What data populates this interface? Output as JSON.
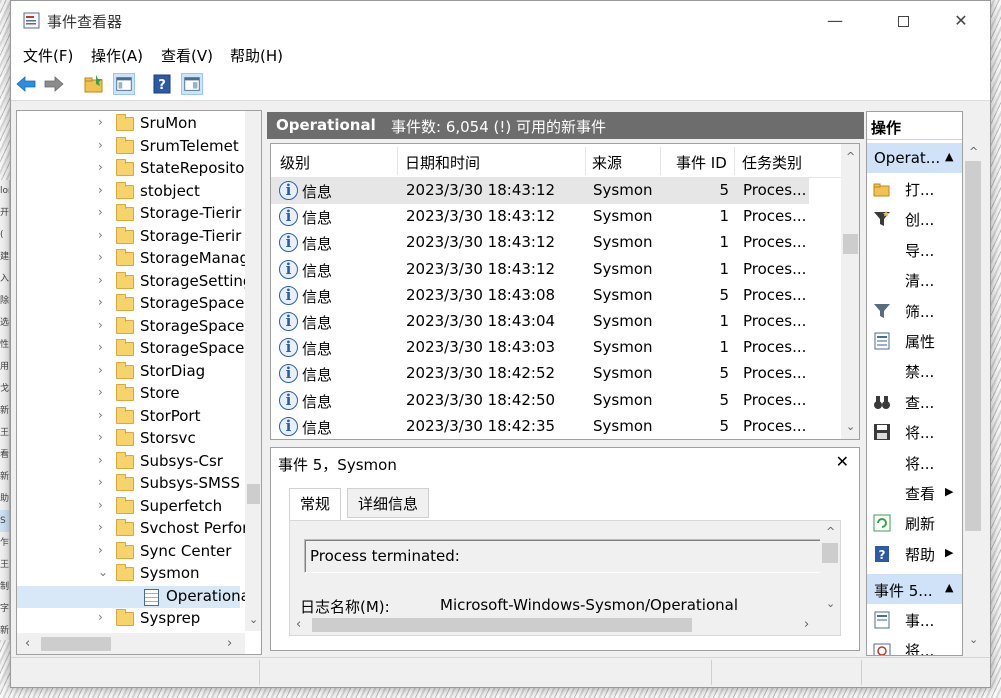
{
  "window": {
    "title": "事件查看器",
    "minimize_glyph": "—",
    "close_glyph": "✕"
  },
  "menu": [
    "文件(F)",
    "操作(A)",
    "查看(V)",
    "帮助(H)"
  ],
  "toolbar": {
    "icons": [
      "back-arrow-icon",
      "forward-arrow-icon",
      "open-folder-icon",
      "show-hide-tree-icon",
      "help-icon",
      "show-hide-action-pane-icon"
    ]
  },
  "left_edge": {
    "fragments": [
      "lor",
      "开(",
      "建",
      "入|",
      "除",
      "选",
      "性",
      "用|",
      "戈",
      "新",
      "王",
      "看",
      "新",
      "助",
      "S",
      "乍",
      "王",
      "制",
      "字",
      "新"
    ]
  },
  "tree": {
    "expand_glyph": "›",
    "collapse_glyph": "⌄",
    "items": [
      {
        "label": "SruMon",
        "state": "collapsed"
      },
      {
        "label": "SrumTelemet",
        "state": "collapsed"
      },
      {
        "label": "StateReposito",
        "state": "collapsed"
      },
      {
        "label": "stobject",
        "state": "collapsed"
      },
      {
        "label": "Storage-Tierir",
        "state": "collapsed"
      },
      {
        "label": "Storage-Tierir",
        "state": "collapsed"
      },
      {
        "label": "StorageManag",
        "state": "collapsed"
      },
      {
        "label": "StorageSetting",
        "state": "collapsed"
      },
      {
        "label": "StorageSpace",
        "state": "collapsed"
      },
      {
        "label": "StorageSpace",
        "state": "collapsed"
      },
      {
        "label": "StorageSpace",
        "state": "collapsed"
      },
      {
        "label": "StorDiag",
        "state": "collapsed"
      },
      {
        "label": "Store",
        "state": "collapsed"
      },
      {
        "label": "StorPort",
        "state": "collapsed"
      },
      {
        "label": "Storsvc",
        "state": "collapsed"
      },
      {
        "label": "Subsys-Csr",
        "state": "collapsed"
      },
      {
        "label": "Subsys-SMSS",
        "state": "collapsed"
      },
      {
        "label": "Superfetch",
        "state": "collapsed"
      },
      {
        "label": "Svchost Perfor",
        "state": "collapsed"
      },
      {
        "label": "Sync Center",
        "state": "collapsed"
      },
      {
        "label": "Sysmon",
        "state": "expanded"
      },
      {
        "label": "Operationa",
        "state": "child-selected"
      },
      {
        "label": "Sysprep",
        "state": "collapsed"
      }
    ]
  },
  "log_header": {
    "name": "Operational",
    "summary": "事件数: 6,054 (!) 可用的新事件"
  },
  "grid": {
    "columns": [
      "级别",
      "日期和时间",
      "来源",
      "事件 ID",
      "任务类别"
    ],
    "rows": [
      {
        "level": "信息",
        "datetime": "2023/3/30 18:43:12",
        "source": "Sysmon",
        "event_id": "5",
        "task": "Proces..."
      },
      {
        "level": "信息",
        "datetime": "2023/3/30 18:43:12",
        "source": "Sysmon",
        "event_id": "1",
        "task": "Proces..."
      },
      {
        "level": "信息",
        "datetime": "2023/3/30 18:43:12",
        "source": "Sysmon",
        "event_id": "1",
        "task": "Proces..."
      },
      {
        "level": "信息",
        "datetime": "2023/3/30 18:43:12",
        "source": "Sysmon",
        "event_id": "1",
        "task": "Proces..."
      },
      {
        "level": "信息",
        "datetime": "2023/3/30 18:43:08",
        "source": "Sysmon",
        "event_id": "5",
        "task": "Proces..."
      },
      {
        "level": "信息",
        "datetime": "2023/3/30 18:43:04",
        "source": "Sysmon",
        "event_id": "1",
        "task": "Proces..."
      },
      {
        "level": "信息",
        "datetime": "2023/3/30 18:43:03",
        "source": "Sysmon",
        "event_id": "1",
        "task": "Proces..."
      },
      {
        "level": "信息",
        "datetime": "2023/3/30 18:42:52",
        "source": "Sysmon",
        "event_id": "5",
        "task": "Proces..."
      },
      {
        "level": "信息",
        "datetime": "2023/3/30 18:42:50",
        "source": "Sysmon",
        "event_id": "5",
        "task": "Proces..."
      },
      {
        "level": "信息",
        "datetime": "2023/3/30 18:42:35",
        "source": "Sysmon",
        "event_id": "5",
        "task": "Proces..."
      }
    ]
  },
  "detail": {
    "title": "事件 5，Sysmon",
    "close_glyph": "✕",
    "tabs": [
      "常规",
      "详细信息"
    ],
    "message": "Process terminated:",
    "field_label": "日志名称(M):",
    "field_value": "Microsoft-Windows-Sysmon/Operational"
  },
  "actions": {
    "header": "操作",
    "section1": "Operat...",
    "items1": [
      {
        "icon": "open-folder-icon",
        "label": "打..."
      },
      {
        "icon": "filter-star-icon",
        "label": "创..."
      },
      {
        "icon": "",
        "label": "导..."
      },
      {
        "icon": "",
        "label": "清..."
      },
      {
        "icon": "filter-icon",
        "label": "筛..."
      },
      {
        "icon": "properties-icon",
        "label": "属性"
      },
      {
        "icon": "",
        "label": "禁..."
      },
      {
        "icon": "binoculars-icon",
        "label": "查..."
      },
      {
        "icon": "save-icon",
        "label": "将..."
      },
      {
        "icon": "",
        "label": "将..."
      },
      {
        "icon": "",
        "label": "查看",
        "submenu": true
      },
      {
        "icon": "refresh-icon",
        "label": "刷新"
      },
      {
        "icon": "help-icon",
        "label": "帮助",
        "submenu": true
      }
    ],
    "section2": "事件 5...",
    "items2": [
      {
        "icon": "event-properties-icon",
        "label": "事..."
      },
      {
        "icon": "attach-task-icon",
        "label": "将..."
      }
    ],
    "collapse_glyph": "▲",
    "submenu_glyph": "▶"
  },
  "colors": {
    "header_bg": "#6d6d6d",
    "selection": "#cfe2f7",
    "info_icon": "#2a5fa8",
    "folder": "#f6d36b"
  }
}
